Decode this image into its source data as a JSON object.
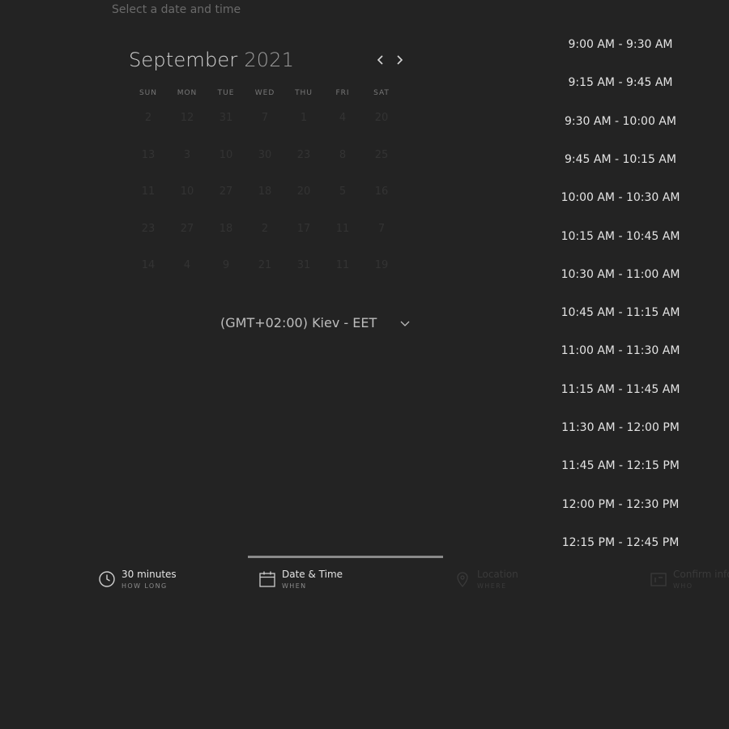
{
  "header": {
    "subtitle": "Select a date and time"
  },
  "calendar": {
    "month": "September",
    "year": "2021",
    "weekdays": [
      "SUN",
      "MON",
      "TUE",
      "WED",
      "THU",
      "FRI",
      "SAT"
    ],
    "rows": [
      [
        "2",
        "12",
        "31",
        "7",
        "1",
        "4",
        "20"
      ],
      [
        "13",
        "3",
        "10",
        "30",
        "23",
        "8",
        "25"
      ],
      [
        "11",
        "10",
        "27",
        "18",
        "20",
        "5",
        "16"
      ],
      [
        "23",
        "27",
        "18",
        "2",
        "17",
        "11",
        "7"
      ],
      [
        "14",
        "4",
        "9",
        "21",
        "31",
        "11",
        "19"
      ]
    ]
  },
  "timezone": {
    "label": "(GMT+02:00) Kiev - EET"
  },
  "time_slots": [
    "9:00 AM - 9:30 AM",
    "9:15 AM - 9:45 AM",
    "9:30 AM - 10:00 AM",
    "9:45 AM - 10:15 AM",
    "10:00 AM - 10:30 AM",
    "10:15 AM - 10:45 AM",
    "10:30 AM - 11:00 AM",
    "10:45 AM - 11:15 AM",
    "11:00 AM - 11:30 AM",
    "11:15 AM - 11:45 AM",
    "11:30 AM - 12:00 PM",
    "11:45 AM - 12:15 PM",
    "12:00 PM - 12:30 PM",
    "12:15 PM - 12:45 PM"
  ],
  "steps": [
    {
      "title": "30 minutes",
      "sub": "HOW LONG",
      "icon": "clock-icon"
    },
    {
      "title": "Date & Time",
      "sub": "WHEN",
      "icon": "calendar-icon"
    },
    {
      "title": "Location",
      "sub": "WHERE",
      "icon": "location-pin-icon"
    },
    {
      "title": "Confirm info",
      "sub": "WHO",
      "icon": "id-card-icon"
    }
  ],
  "colors": {
    "background": "#232323",
    "text_primary": "#e4e4e4",
    "text_muted": "#6a6a6a",
    "active_step_bar": "#8a8a8a"
  }
}
